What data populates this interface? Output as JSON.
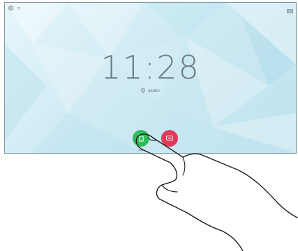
{
  "clock": {
    "time": "11:28"
  },
  "location": {
    "name": "acano"
  },
  "buttons": {
    "call_label": "Call"
  },
  "colors": {
    "call": "#2ebd59",
    "share": "#e23a5a",
    "accent_bg": "#cfeaf3"
  },
  "icons": {
    "status_left": [
      "settings-icon",
      "wifi-icon"
    ],
    "status_right": "screen-icon",
    "location": "location-pin-icon",
    "call": "phone-icon",
    "share": "share-screen-icon"
  }
}
